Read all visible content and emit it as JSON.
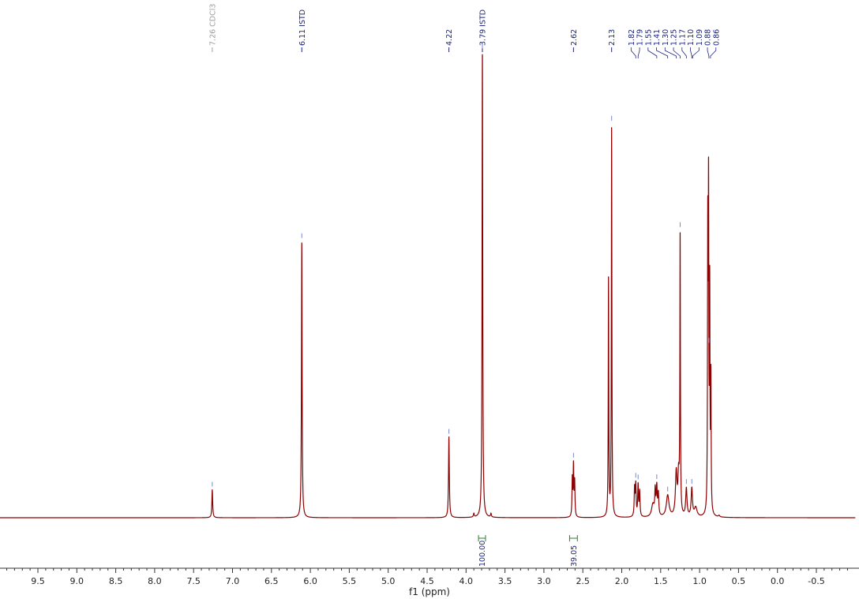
{
  "chart_data": {
    "type": "line",
    "xlabel": "f1 (ppm)",
    "xlim": [
      10.1,
      -1.0
    ],
    "x_reversed": true,
    "ylim": [
      -0.04,
      1.42
    ],
    "grid": false,
    "x_ticks": [
      9.5,
      9.0,
      8.5,
      8.0,
      7.5,
      7.0,
      6.5,
      6.0,
      5.5,
      5.0,
      4.5,
      4.0,
      3.5,
      3.0,
      2.5,
      2.0,
      1.5,
      1.0,
      0.5,
      0.0,
      -0.5
    ],
    "x_tick_labels": [
      "9.5",
      "9.0",
      "8.5",
      "8.0",
      "7.5",
      "7.0",
      "6.5",
      "6.0",
      "5.5",
      "5.0",
      "4.5",
      "4.0",
      "3.5",
      "3.0",
      "2.5",
      "2.0",
      "1.5",
      "1.0",
      "0.5",
      "0.0",
      "-0.5"
    ],
    "colors": {
      "spectrum": "#8b0000",
      "peak_label": "#1a237e",
      "solvent_label": "#9e9e9e",
      "integral": "#2e7d32",
      "peak_marker": "#7986cb"
    },
    "peaks": [
      {
        "ppm": 7.26,
        "height": 0.09,
        "width": 0.006
      },
      {
        "ppm": 6.11,
        "height": 0.89,
        "width": 0.005
      },
      {
        "ppm": 4.22,
        "height": 0.26,
        "width": 0.006
      },
      {
        "ppm": 3.9,
        "height": 0.012,
        "width": 0.006
      },
      {
        "ppm": 3.79,
        "height": 1.5,
        "width": 0.005
      },
      {
        "ppm": 3.68,
        "height": 0.012,
        "width": 0.006
      },
      {
        "ppm": 2.635,
        "height": 0.12,
        "width": 0.005
      },
      {
        "ppm": 2.62,
        "height": 0.16,
        "width": 0.005
      },
      {
        "ppm": 2.605,
        "height": 0.11,
        "width": 0.005
      },
      {
        "ppm": 2.17,
        "height": 0.77,
        "width": 0.004
      },
      {
        "ppm": 2.13,
        "height": 1.26,
        "width": 0.004
      },
      {
        "ppm": 1.835,
        "height": 0.09,
        "width": 0.006
      },
      {
        "ppm": 1.82,
        "height": 0.1,
        "width": 0.006
      },
      {
        "ppm": 1.79,
        "height": 0.1,
        "width": 0.006
      },
      {
        "ppm": 1.77,
        "height": 0.08,
        "width": 0.006
      },
      {
        "ppm": 1.57,
        "height": 0.08,
        "width": 0.007
      },
      {
        "ppm": 1.55,
        "height": 0.09,
        "width": 0.007
      },
      {
        "ppm": 1.53,
        "height": 0.07,
        "width": 0.007
      },
      {
        "ppm": 1.6,
        "height": 0.04,
        "width": 0.02
      },
      {
        "ppm": 1.41,
        "height": 0.07,
        "width": 0.02
      },
      {
        "ppm": 1.3,
        "height": 0.14,
        "width": 0.012
      },
      {
        "ppm": 1.27,
        "height": 0.12,
        "width": 0.01
      },
      {
        "ppm": 1.25,
        "height": 0.89,
        "width": 0.004
      },
      {
        "ppm": 1.17,
        "height": 0.09,
        "width": 0.01
      },
      {
        "ppm": 1.1,
        "height": 0.09,
        "width": 0.01
      },
      {
        "ppm": 1.05,
        "height": 0.03,
        "width": 0.02
      },
      {
        "ppm": 0.895,
        "height": 0.88,
        "width": 0.004
      },
      {
        "ppm": 0.885,
        "height": 0.99,
        "width": 0.004
      },
      {
        "ppm": 0.87,
        "height": 0.7,
        "width": 0.004
      },
      {
        "ppm": 0.855,
        "height": 0.42,
        "width": 0.004
      },
      {
        "ppm": 0.75,
        "height": 0.005,
        "width": 0.01
      }
    ],
    "labels_left": [
      {
        "text": "7.26 CDCl3",
        "ppm": 7.26,
        "solvent": true
      },
      {
        "text": "6.11 ISTD",
        "ppm": 6.11,
        "solvent": false
      },
      {
        "text": "4.22",
        "ppm": 4.22,
        "solvent": false
      },
      {
        "text": "3.79 ISTD",
        "ppm": 3.79,
        "solvent": false
      },
      {
        "text": "2.62",
        "ppm": 2.62,
        "solvent": false
      },
      {
        "text": "2.13",
        "ppm": 2.13,
        "solvent": false
      }
    ],
    "labels_cluster": [
      {
        "text": "1.82",
        "ppm": 1.82
      },
      {
        "text": "1.79",
        "ppm": 1.79
      },
      {
        "text": "1.55",
        "ppm": 1.55
      },
      {
        "text": "1.41",
        "ppm": 1.41
      },
      {
        "text": "1.30",
        "ppm": 1.3
      },
      {
        "text": "1.25",
        "ppm": 1.25
      },
      {
        "text": "1.17",
        "ppm": 1.17
      },
      {
        "text": "1.10",
        "ppm": 1.1
      },
      {
        "text": "1.09",
        "ppm": 1.09
      },
      {
        "text": "0.88",
        "ppm": 0.88
      },
      {
        "text": "0.86",
        "ppm": 0.86
      }
    ],
    "integrals": [
      {
        "value": "100.00",
        "from": 3.84,
        "to": 3.75
      },
      {
        "value": "39.05",
        "from": 2.67,
        "to": 2.57
      }
    ]
  }
}
